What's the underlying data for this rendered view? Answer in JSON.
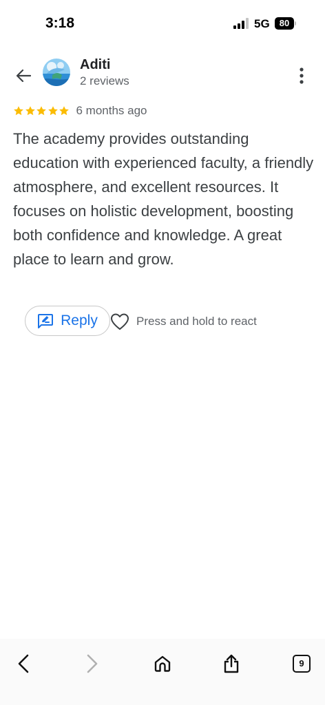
{
  "status_bar": {
    "time": "3:18",
    "network": "5G",
    "battery": "80",
    "signal_icon": "cellular-signal-icon"
  },
  "header": {
    "back_icon": "arrow-left-icon",
    "reviewer_name": "Aditi",
    "review_count": "2 reviews",
    "more_icon": "more-vertical-icon"
  },
  "review": {
    "rating": 5,
    "rating_max": 5,
    "star_color": "#fbbc04",
    "date": "6 months ago",
    "text": "The academy provides outstanding education with experienced faculty, a friendly atmosphere, and excellent resources. It focuses on holistic development, boosting both confidence and knowledge. A great place to learn and grow."
  },
  "actions": {
    "reply_label": "Reply",
    "reply_icon": "reply-feedback-icon",
    "react_icon": "heart-outline-icon",
    "react_hint": "Press and hold to react"
  },
  "browser_bar": {
    "back_icon": "chevron-left-icon",
    "forward_icon": "chevron-right-icon",
    "home_icon": "home-icon",
    "share_icon": "share-icon",
    "tabs_count": "9"
  },
  "colors": {
    "accent": "#1a73e8",
    "star": "#fbbc04",
    "secondary_text": "#5f6368"
  }
}
